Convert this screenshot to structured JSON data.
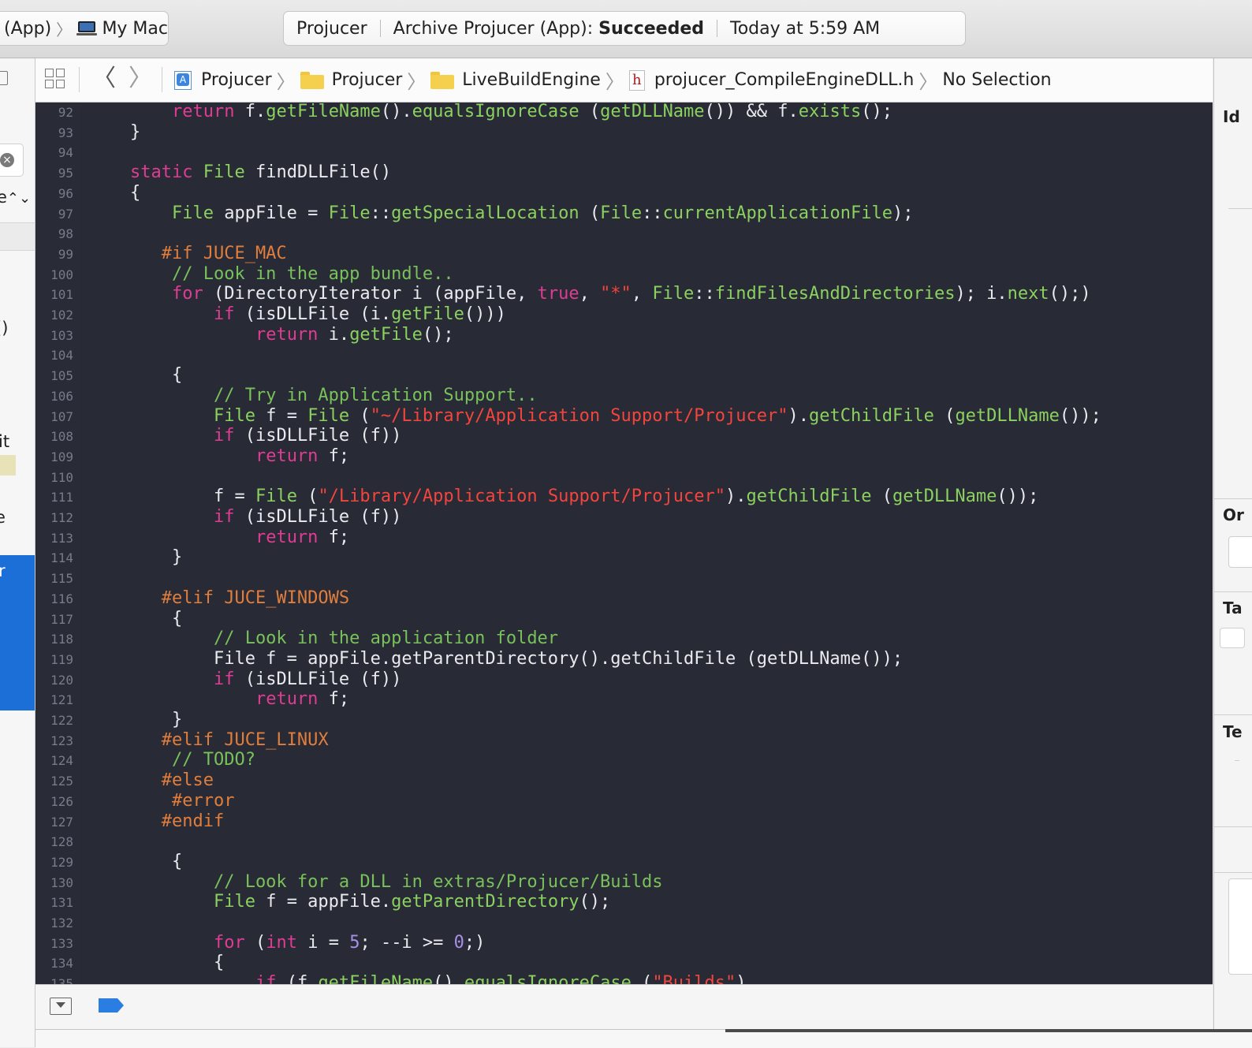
{
  "toolbar": {
    "scheme": {
      "target": "(App)",
      "destination": "My Mac",
      "destination_icon": "laptop-icon"
    },
    "activity": {
      "app": "Projucer",
      "status_prefix": "Archive Projucer (App): ",
      "status_result": "Succeeded",
      "time": "Today at 5:59 AM"
    }
  },
  "navigator": {
    "fragments": [
      "e",
      "()",
      "it",
      "e",
      "r"
    ]
  },
  "jumpbar": {
    "back_icon": "chevron-left-icon",
    "forward_icon": "chevron-right-icon",
    "breadcrumb": [
      {
        "label": "Projucer",
        "icon": "project-icon"
      },
      {
        "label": "Projucer",
        "icon": "folder-icon"
      },
      {
        "label": "LiveBuildEngine",
        "icon": "folder-icon"
      },
      {
        "label": "projucer_CompileEngineDLL.h",
        "icon": "header-file-icon"
      },
      {
        "label": "No Selection",
        "icon": ""
      }
    ]
  },
  "editor": {
    "lines": [
      {
        "n": "92",
        "t": [
          {
            "c": "",
            "s": "    "
          },
          {
            "c": "kw",
            "s": "return"
          },
          {
            "c": "",
            "s": " f."
          },
          {
            "c": "fn",
            "s": "getFileName"
          },
          {
            "c": "",
            "s": "()."
          },
          {
            "c": "fn",
            "s": "equalsIgnoreCase"
          },
          {
            "c": "",
            "s": " ("
          },
          {
            "c": "fn",
            "s": "getDLLName"
          },
          {
            "c": "",
            "s": "()) && f."
          },
          {
            "c": "fn",
            "s": "exists"
          },
          {
            "c": "",
            "s": "();"
          }
        ]
      },
      {
        "n": "93",
        "t": [
          {
            "c": "",
            "s": "}"
          }
        ]
      },
      {
        "n": "94",
        "t": []
      },
      {
        "n": "95",
        "t": [
          {
            "c": "kw",
            "s": "static"
          },
          {
            "c": "",
            "s": " "
          },
          {
            "c": "ty",
            "s": "File"
          },
          {
            "c": "",
            "s": " findDLLFile()"
          }
        ]
      },
      {
        "n": "96",
        "t": [
          {
            "c": "",
            "s": "{"
          }
        ]
      },
      {
        "n": "97",
        "t": [
          {
            "c": "",
            "s": "    "
          },
          {
            "c": "ty",
            "s": "File"
          },
          {
            "c": "",
            "s": " appFile = "
          },
          {
            "c": "ty",
            "s": "File"
          },
          {
            "c": "",
            "s": "::"
          },
          {
            "c": "fn",
            "s": "getSpecialLocation"
          },
          {
            "c": "",
            "s": " ("
          },
          {
            "c": "ty",
            "s": "File"
          },
          {
            "c": "",
            "s": "::"
          },
          {
            "c": "fn",
            "s": "currentApplicationFile"
          },
          {
            "c": "",
            "s": ");"
          }
        ]
      },
      {
        "n": "98",
        "t": []
      },
      {
        "n": "99",
        "t": [
          {
            "c": "pp",
            "s": "   #if JUCE_MAC"
          }
        ]
      },
      {
        "n": "100",
        "t": [
          {
            "c": "cm",
            "s": "    // Look in the app bundle.."
          }
        ]
      },
      {
        "n": "101",
        "t": [
          {
            "c": "",
            "s": "    "
          },
          {
            "c": "kw",
            "s": "for"
          },
          {
            "c": "",
            "s": " (DirectoryIterator i (appFile, "
          },
          {
            "c": "kw",
            "s": "true"
          },
          {
            "c": "",
            "s": ", "
          },
          {
            "c": "st",
            "s": "\"*\""
          },
          {
            "c": "",
            "s": ", "
          },
          {
            "c": "ty",
            "s": "File"
          },
          {
            "c": "",
            "s": "::"
          },
          {
            "c": "fn",
            "s": "findFilesAndDirectories"
          },
          {
            "c": "",
            "s": "); i."
          },
          {
            "c": "fn",
            "s": "next"
          },
          {
            "c": "",
            "s": "();)"
          }
        ]
      },
      {
        "n": "102",
        "t": [
          {
            "c": "",
            "s": "        "
          },
          {
            "c": "kw",
            "s": "if"
          },
          {
            "c": "",
            "s": " (isDLLFile (i."
          },
          {
            "c": "fn",
            "s": "getFile"
          },
          {
            "c": "",
            "s": "()))"
          }
        ]
      },
      {
        "n": "103",
        "t": [
          {
            "c": "",
            "s": "            "
          },
          {
            "c": "kw",
            "s": "return"
          },
          {
            "c": "",
            "s": " i."
          },
          {
            "c": "fn",
            "s": "getFile"
          },
          {
            "c": "",
            "s": "();"
          }
        ]
      },
      {
        "n": "104",
        "t": []
      },
      {
        "n": "105",
        "t": [
          {
            "c": "",
            "s": "    {"
          }
        ]
      },
      {
        "n": "106",
        "t": [
          {
            "c": "cm",
            "s": "        // Try in Application Support.."
          }
        ]
      },
      {
        "n": "107",
        "t": [
          {
            "c": "",
            "s": "        "
          },
          {
            "c": "ty",
            "s": "File"
          },
          {
            "c": "",
            "s": " f = "
          },
          {
            "c": "ty",
            "s": "File"
          },
          {
            "c": "",
            "s": " ("
          },
          {
            "c": "st",
            "s": "\"~/Library/Application Support/Projucer\""
          },
          {
            "c": "",
            "s": ")."
          },
          {
            "c": "fn",
            "s": "getChildFile"
          },
          {
            "c": "",
            "s": " ("
          },
          {
            "c": "fn",
            "s": "getDLLName"
          },
          {
            "c": "",
            "s": "());"
          }
        ]
      },
      {
        "n": "108",
        "t": [
          {
            "c": "",
            "s": "        "
          },
          {
            "c": "kw",
            "s": "if"
          },
          {
            "c": "",
            "s": " (isDLLFile (f))"
          }
        ]
      },
      {
        "n": "109",
        "t": [
          {
            "c": "",
            "s": "            "
          },
          {
            "c": "kw",
            "s": "return"
          },
          {
            "c": "",
            "s": " f;"
          }
        ]
      },
      {
        "n": "110",
        "t": []
      },
      {
        "n": "111",
        "t": [
          {
            "c": "",
            "s": "        f = "
          },
          {
            "c": "ty",
            "s": "File"
          },
          {
            "c": "",
            "s": " ("
          },
          {
            "c": "st",
            "s": "\"/Library/Application Support/Projucer\""
          },
          {
            "c": "",
            "s": ")."
          },
          {
            "c": "fn",
            "s": "getChildFile"
          },
          {
            "c": "",
            "s": " ("
          },
          {
            "c": "fn",
            "s": "getDLLName"
          },
          {
            "c": "",
            "s": "());"
          }
        ]
      },
      {
        "n": "112",
        "t": [
          {
            "c": "",
            "s": "        "
          },
          {
            "c": "kw",
            "s": "if"
          },
          {
            "c": "",
            "s": " (isDLLFile (f))"
          }
        ]
      },
      {
        "n": "113",
        "t": [
          {
            "c": "",
            "s": "            "
          },
          {
            "c": "kw",
            "s": "return"
          },
          {
            "c": "",
            "s": " f;"
          }
        ]
      },
      {
        "n": "114",
        "t": [
          {
            "c": "",
            "s": "    }"
          }
        ]
      },
      {
        "n": "115",
        "t": []
      },
      {
        "n": "116",
        "t": [
          {
            "c": "pp",
            "s": "   #elif JUCE_WINDOWS"
          }
        ]
      },
      {
        "n": "117",
        "t": [
          {
            "c": "",
            "s": "    {"
          }
        ]
      },
      {
        "n": "118",
        "t": [
          {
            "c": "cm",
            "s": "        // Look in the application folder"
          }
        ]
      },
      {
        "n": "119",
        "t": [
          {
            "c": "",
            "s": "        File f = appFile.getParentDirectory().getChildFile (getDLLName());"
          }
        ]
      },
      {
        "n": "120",
        "t": [
          {
            "c": "",
            "s": "        "
          },
          {
            "c": "kw",
            "s": "if"
          },
          {
            "c": "",
            "s": " (isDLLFile (f))"
          }
        ]
      },
      {
        "n": "121",
        "t": [
          {
            "c": "",
            "s": "            "
          },
          {
            "c": "kw",
            "s": "return"
          },
          {
            "c": "",
            "s": " f;"
          }
        ]
      },
      {
        "n": "122",
        "t": [
          {
            "c": "",
            "s": "    }"
          }
        ]
      },
      {
        "n": "123",
        "t": [
          {
            "c": "pp",
            "s": "   #elif JUCE_LINUX"
          }
        ]
      },
      {
        "n": "124",
        "t": [
          {
            "c": "cm",
            "s": "    // TODO?"
          }
        ]
      },
      {
        "n": "125",
        "t": [
          {
            "c": "pp",
            "s": "   #else"
          }
        ]
      },
      {
        "n": "126",
        "t": [
          {
            "c": "pp",
            "s": "    #error"
          }
        ]
      },
      {
        "n": "127",
        "t": [
          {
            "c": "pp",
            "s": "   #endif"
          }
        ]
      },
      {
        "n": "128",
        "t": []
      },
      {
        "n": "129",
        "t": [
          {
            "c": "",
            "s": "    {"
          }
        ]
      },
      {
        "n": "130",
        "t": [
          {
            "c": "cm",
            "s": "        // Look for a DLL in extras/Projucer/Builds"
          }
        ]
      },
      {
        "n": "131",
        "t": [
          {
            "c": "",
            "s": "        "
          },
          {
            "c": "ty",
            "s": "File"
          },
          {
            "c": "",
            "s": " f = appFile."
          },
          {
            "c": "fn",
            "s": "getParentDirectory"
          },
          {
            "c": "",
            "s": "();"
          }
        ]
      },
      {
        "n": "132",
        "t": []
      },
      {
        "n": "133",
        "t": [
          {
            "c": "",
            "s": "        "
          },
          {
            "c": "kw",
            "s": "for"
          },
          {
            "c": "",
            "s": " ("
          },
          {
            "c": "kw",
            "s": "int"
          },
          {
            "c": "",
            "s": " i = "
          },
          {
            "c": "nu",
            "s": "5"
          },
          {
            "c": "",
            "s": "; --i >= "
          },
          {
            "c": "nu",
            "s": "0"
          },
          {
            "c": "",
            "s": ";)"
          }
        ]
      },
      {
        "n": "134",
        "t": [
          {
            "c": "",
            "s": "        {"
          }
        ]
      },
      {
        "n": "135",
        "t": [
          {
            "c": "",
            "s": "            "
          },
          {
            "c": "kw",
            "s": "if"
          },
          {
            "c": "",
            "s": " (f."
          },
          {
            "c": "fn",
            "s": "getFileName"
          },
          {
            "c": "",
            "s": "()."
          },
          {
            "c": "fn",
            "s": "equalsIgnoreCase"
          },
          {
            "c": "",
            "s": " ("
          },
          {
            "c": "st",
            "s": "\"Builds\""
          },
          {
            "c": "",
            "s": ")"
          }
        ]
      }
    ]
  },
  "debugbar": {
    "hide_icon": "hide-debug-area-icon",
    "breakpoints_icon": "breakpoints-toggle-icon"
  },
  "inspector": {
    "labels": [
      "Id",
      "Or",
      "Ta",
      "Te"
    ]
  },
  "colors": {
    "editor_bg": "#282a35",
    "keyword": "#de3d93",
    "type": "#8bd15f",
    "comment": "#79c15a",
    "preprocessor": "#e07e3e",
    "string": "#f2453d",
    "number": "#a690e8",
    "selection_blue": "#1b6fd6"
  }
}
